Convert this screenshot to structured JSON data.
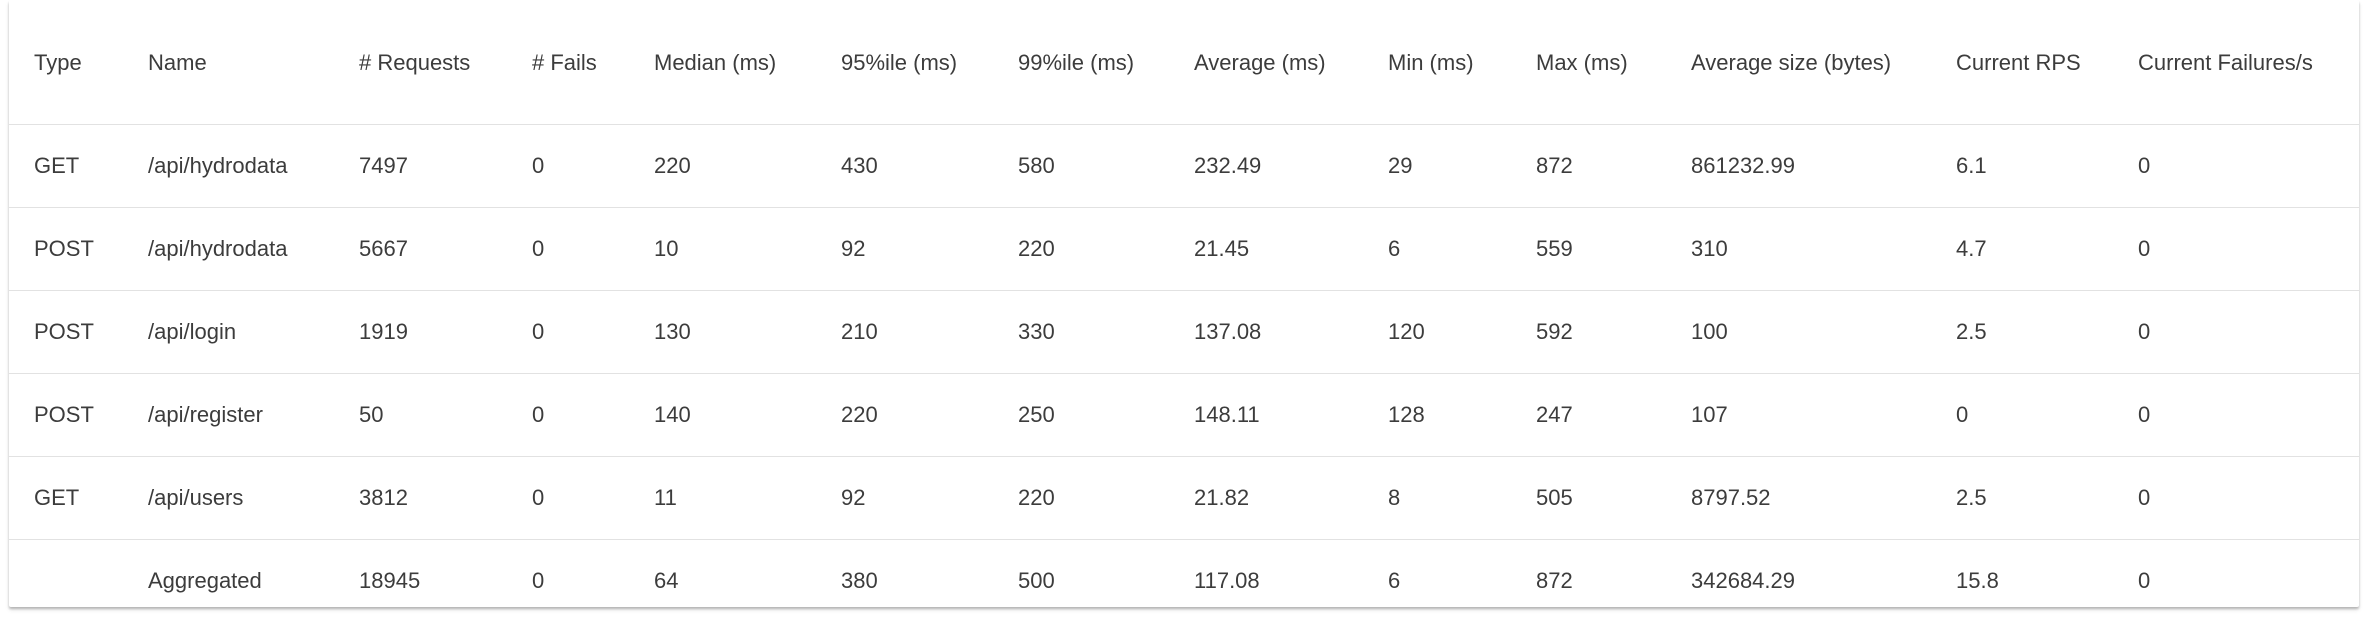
{
  "stats_table": {
    "columns": [
      "Type",
      "Name",
      "# Requests",
      "# Fails",
      "Median (ms)",
      "95%ile (ms)",
      "99%ile (ms)",
      "Average (ms)",
      "Min (ms)",
      "Max (ms)",
      "Average size (bytes)",
      "Current RPS",
      "Current Failures/s"
    ],
    "rows": [
      [
        "GET",
        "/api/hydrodata",
        "7497",
        "0",
        "220",
        "430",
        "580",
        "232.49",
        "29",
        "872",
        "861232.99",
        "6.1",
        "0"
      ],
      [
        "POST",
        "/api/hydrodata",
        "5667",
        "0",
        "10",
        "92",
        "220",
        "21.45",
        "6",
        "559",
        "310",
        "4.7",
        "0"
      ],
      [
        "POST",
        "/api/login",
        "1919",
        "0",
        "130",
        "210",
        "330",
        "137.08",
        "120",
        "592",
        "100",
        "2.5",
        "0"
      ],
      [
        "POST",
        "/api/register",
        "50",
        "0",
        "140",
        "220",
        "250",
        "148.11",
        "128",
        "247",
        "107",
        "0",
        "0"
      ],
      [
        "GET",
        "/api/users",
        "3812",
        "0",
        "11",
        "92",
        "220",
        "21.82",
        "8",
        "505",
        "8797.52",
        "2.5",
        "0"
      ],
      [
        "",
        "Aggregated",
        "18945",
        "0",
        "64",
        "380",
        "500",
        "117.08",
        "6",
        "872",
        "342684.29",
        "15.8",
        "0"
      ]
    ]
  }
}
